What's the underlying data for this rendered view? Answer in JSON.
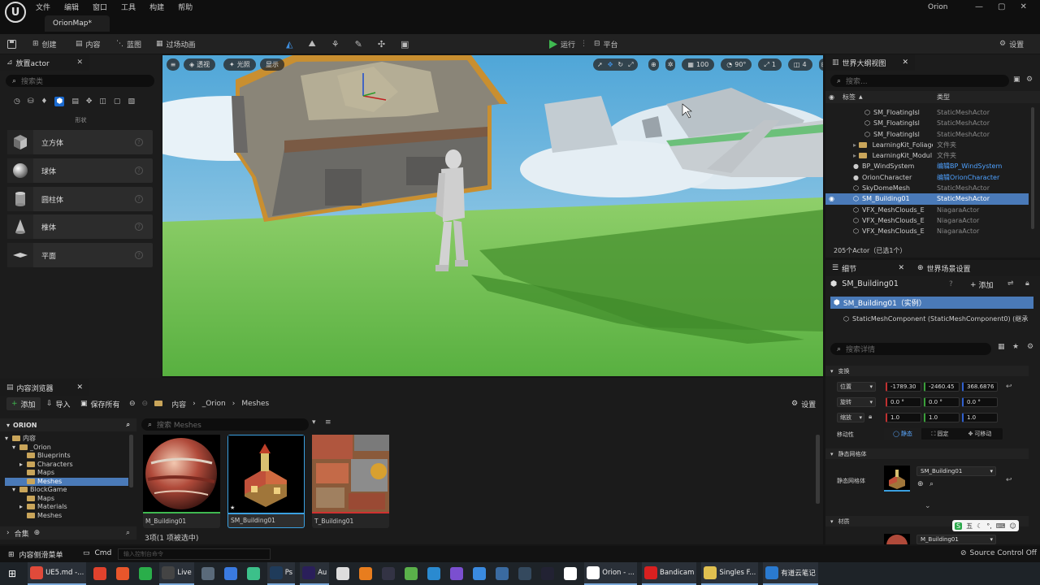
{
  "app": {
    "logo_text": "U",
    "menus": [
      "文件",
      "编辑",
      "窗口",
      "工具",
      "构建",
      "帮助"
    ],
    "map_tab": "OrionMap*",
    "project_name": "Orion",
    "window_buttons": [
      "—",
      "▢",
      "✕"
    ]
  },
  "toolbar": {
    "create": "创建",
    "content": "内容",
    "blueprint": "蓝图",
    "cinematics": "过场动画",
    "play": "运行",
    "platform": "平台",
    "settings": "设置"
  },
  "place_actors": {
    "tab_title": "放置actor",
    "search_placeholder": "搜索类",
    "category_label": "形状",
    "items": [
      {
        "label": "立方体",
        "icon": "cube-icon"
      },
      {
        "label": "球体",
        "icon": "sphere-icon"
      },
      {
        "label": "圆柱体",
        "icon": "cylinder-icon"
      },
      {
        "label": "椎体",
        "icon": "cone-icon"
      },
      {
        "label": "平面",
        "icon": "plane-icon"
      }
    ]
  },
  "viewport": {
    "menu_icon": "≡",
    "perspective": "透视",
    "lit": "光照",
    "show": "显示",
    "grid_value": "100",
    "angle_value": "90°",
    "scale_value": "1",
    "camera_speed": "4"
  },
  "content_browser": {
    "tab_title": "内容浏览器",
    "add": "添加",
    "import": "导入",
    "save_all": "保存所有",
    "breadcrumb": [
      "内容",
      "_Orion",
      "Meshes"
    ],
    "settings": "设置",
    "root": "ORION",
    "search_placeholder": "搜索 Meshes",
    "tree": [
      {
        "label": "内容",
        "indent": 0,
        "arrow": "▾"
      },
      {
        "label": "_Orion",
        "indent": 1,
        "arrow": "▾"
      },
      {
        "label": "Blueprints",
        "indent": 2,
        "arrow": ""
      },
      {
        "label": "Characters",
        "indent": 2,
        "arrow": "▸"
      },
      {
        "label": "Maps",
        "indent": 2,
        "arrow": ""
      },
      {
        "label": "Meshes",
        "indent": 2,
        "arrow": "",
        "selected": true
      },
      {
        "label": "BlockGame",
        "indent": 1,
        "arrow": "▾"
      },
      {
        "label": "Maps",
        "indent": 2,
        "arrow": ""
      },
      {
        "label": "Materials",
        "indent": 2,
        "arrow": "▸"
      },
      {
        "label": "Meshes",
        "indent": 2,
        "arrow": ""
      }
    ],
    "assets": [
      {
        "name": "M_Building01",
        "type": "material"
      },
      {
        "name": "SM_Building01",
        "type": "static-mesh",
        "selected": true
      },
      {
        "name": "T_Building01",
        "type": "texture"
      }
    ],
    "collections": "合集",
    "status": "3项(1 项被选中)"
  },
  "outliner": {
    "tab_title": "世界大纲视图",
    "search_placeholder": "搜索...",
    "col_label": "标签",
    "col_type": "类型",
    "rows": [
      {
        "label": "SM_FloatingIsl",
        "type": "StaticMeshActor",
        "indent": 2
      },
      {
        "label": "SM_FloatingIsl",
        "type": "StaticMeshActor",
        "indent": 2
      },
      {
        "label": "SM_FloatingIsl",
        "type": "StaticMeshActor",
        "indent": 2
      },
      {
        "label": "LearningKit_Foliage",
        "type": "文件夹",
        "indent": 1,
        "folder": true
      },
      {
        "label": "LearningKit_Modul",
        "type": "文件夹",
        "indent": 1,
        "folder": true
      },
      {
        "label": "BP_WindSystem",
        "type": "编辑BP_WindSystem",
        "indent": 1,
        "link": true
      },
      {
        "label": "OrionCharacter",
        "type": "编辑OrionCharacter",
        "indent": 1,
        "link": true
      },
      {
        "label": "SkyDomeMesh",
        "type": "StaticMeshActor",
        "indent": 1
      },
      {
        "label": "SM_Building01",
        "type": "StaticMeshActor",
        "indent": 1,
        "selected": true
      },
      {
        "label": "VFX_MeshClouds_E",
        "type": "NiagaraActor",
        "indent": 1
      },
      {
        "label": "VFX_MeshClouds_E",
        "type": "NiagaraActor",
        "indent": 1
      },
      {
        "label": "VFX_MeshClouds_E",
        "type": "NiagaraActor",
        "indent": 1
      }
    ],
    "count": "205个Actor（已选1个）"
  },
  "details": {
    "tab_details": "细节",
    "tab_world": "世界场景设置",
    "actor_name": "SM_Building01",
    "add": "添加",
    "instance_row": "SM_Building01（实例）",
    "component_row": "StaticMeshComponent (StaticMeshComponent0) (继承",
    "search_placeholder": "搜索详情",
    "transform_section": "变换",
    "location_label": "位置",
    "rotation_label": "旋转",
    "scale_label": "缩放",
    "location": [
      "-1789.30",
      "-2460.45",
      "368.6876"
    ],
    "rotation": [
      "0.0 °",
      "0.0 °",
      "0.0 °"
    ],
    "scale": [
      "1.0",
      "1.0",
      "1.0"
    ],
    "mobility_label": "移动性",
    "mobility_options": [
      "静态",
      "固定",
      "可移动"
    ],
    "static_mesh_section": "静态网格体",
    "static_mesh_label": "静态网格体",
    "static_mesh_value": "SM_Building01",
    "material_section": "材质",
    "material_value": "M_Building01",
    "ime_text": "五"
  },
  "statusbar": {
    "content_drawer": "内容侧滑菜单",
    "cmd": "Cmd",
    "console_placeholder": "输入控制台命令",
    "source_control": "Source Control Off"
  },
  "taskbar": {
    "items": [
      {
        "label": "UE5.md -...",
        "color": "#e04a3a"
      },
      {
        "label": "",
        "color": "#e0422d"
      },
      {
        "label": "",
        "color": "#e8562b"
      },
      {
        "label": "",
        "color": "#2aae4a"
      },
      {
        "label": "Live",
        "color": "#444"
      },
      {
        "label": "",
        "color": "#5a6a7a"
      },
      {
        "label": "",
        "color": "#3a7ae0"
      },
      {
        "label": "",
        "color": "#3cc08a"
      },
      {
        "label": "Ps",
        "color": "#1f3b5a"
      },
      {
        "label": "Au",
        "color": "#2a1f5a"
      },
      {
        "label": "",
        "color": "#ddd"
      },
      {
        "label": "",
        "color": "#e87d1e"
      },
      {
        "label": "",
        "color": "#334"
      },
      {
        "label": "",
        "color": "#5ab04a"
      },
      {
        "label": "",
        "color": "#2a8ad0"
      },
      {
        "label": "",
        "color": "#7b4fd0"
      },
      {
        "label": "",
        "color": "#3a8ae0"
      },
      {
        "label": "",
        "color": "#3a6aa0"
      },
      {
        "label": "",
        "color": "#34495e"
      },
      {
        "label": "",
        "color": "#223"
      },
      {
        "label": "",
        "color": "#fff"
      },
      {
        "label": "Orion - ...",
        "color": "#fff"
      },
      {
        "label": "Bandicam",
        "color": "#d92020"
      },
      {
        "label": "Singles F...",
        "color": "#e0c050"
      },
      {
        "label": "有道云笔记",
        "color": "#2a7ad0"
      }
    ]
  },
  "colors": {
    "accent_blue": "#3f7fd0",
    "selected_row": "#4a7ab8",
    "play_green": "#3fb950",
    "link_blue": "#4ea1ff",
    "selection_outline": "#e8a33a"
  }
}
